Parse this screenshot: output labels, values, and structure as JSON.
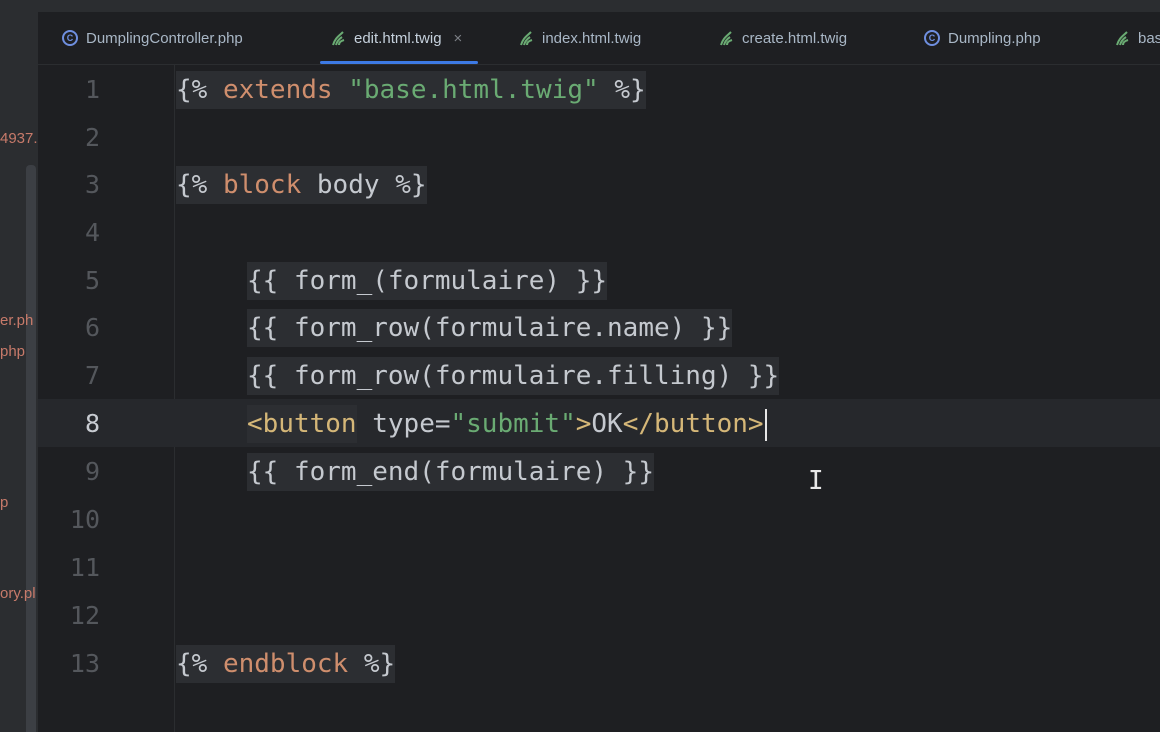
{
  "tabs": [
    {
      "label": "DumplingController.php",
      "icon": "php-class-icon"
    },
    {
      "label": "edit.html.twig",
      "icon": "twig-icon",
      "active": true,
      "close": "×"
    },
    {
      "label": "index.html.twig",
      "icon": "twig-icon"
    },
    {
      "label": "create.html.twig",
      "icon": "twig-icon"
    },
    {
      "label": "Dumpling.php",
      "icon": "php-class-icon"
    },
    {
      "label": "bas",
      "icon": "twig-icon"
    }
  ],
  "sidebar_fragments": [
    "4937.",
    "er.ph",
    "php",
    "p",
    "ory.pl"
  ],
  "line_numbers": [
    "1",
    "2",
    "3",
    "4",
    "5",
    "6",
    "7",
    "8",
    "9",
    "10",
    "11",
    "12",
    "13"
  ],
  "current_line": "8",
  "code": {
    "l1": {
      "open": "{%",
      "kw": "extends",
      "str": "\"base.html.twig\"",
      "close": "%}"
    },
    "l3": {
      "open": "{%",
      "kw": "block",
      "name": "body",
      "close": "%}"
    },
    "l5": "{{ form_(formulaire) }}",
    "l6": "{{ form_row(formulaire.name) }}",
    "l7": "{{ form_row(formulaire.filling) }}",
    "l8": {
      "tag_open": "<button",
      "attr": " type=",
      "attr_val": "\"submit\"",
      "gt": ">",
      "text": "OK",
      "tag_close": "</button>"
    },
    "l9": "{{ form_end(formulaire) }}",
    "l13": {
      "open": "{%",
      "kw": "endblock",
      "close": "%}"
    }
  },
  "colors": {
    "keyword": "#cf8e6d",
    "string": "#6aab73",
    "tag": "#d5b778",
    "accent": "#3d7ae5"
  },
  "ibeam_glyph": "I"
}
